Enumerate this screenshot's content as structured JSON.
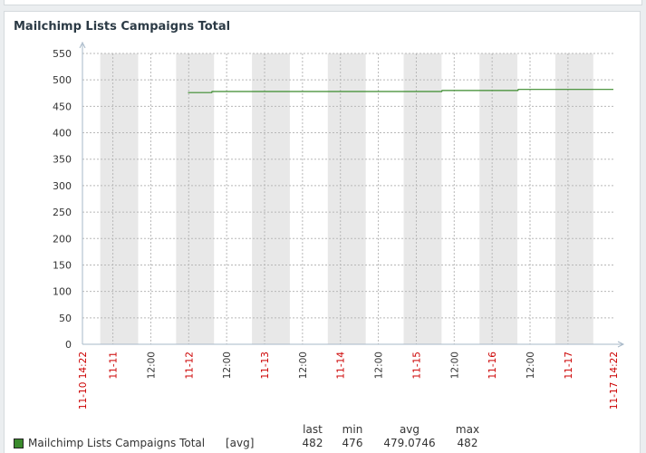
{
  "widget": {
    "title": "Mailchimp Lists Campaigns Total"
  },
  "chart_data": {
    "type": "line",
    "title": "Mailchimp Lists Campaigns Total",
    "ylim": [
      0,
      550
    ],
    "yticks": [
      0,
      50,
      100,
      150,
      200,
      250,
      300,
      350,
      400,
      450,
      500,
      550
    ],
    "x_start": "11-10 14:22",
    "x_end": "11-17 14:22",
    "x_tick_labels": [
      {
        "label": "11-10 14:22",
        "t": 0,
        "color": "#cc0000"
      },
      {
        "label": "11-11",
        "t": 9.63,
        "color": "#cc0000"
      },
      {
        "label": "12:00",
        "t": 21.63,
        "color": "#333333"
      },
      {
        "label": "11-12",
        "t": 33.63,
        "color": "#cc0000"
      },
      {
        "label": "12:00",
        "t": 45.63,
        "color": "#333333"
      },
      {
        "label": "11-13",
        "t": 57.63,
        "color": "#cc0000"
      },
      {
        "label": "12:00",
        "t": 69.63,
        "color": "#333333"
      },
      {
        "label": "11-14",
        "t": 81.63,
        "color": "#cc0000"
      },
      {
        "label": "12:00",
        "t": 93.63,
        "color": "#333333"
      },
      {
        "label": "11-15",
        "t": 105.63,
        "color": "#cc0000"
      },
      {
        "label": "12:00",
        "t": 117.63,
        "color": "#333333"
      },
      {
        "label": "11-16",
        "t": 129.63,
        "color": "#cc0000"
      },
      {
        "label": "12:00",
        "t": 141.63,
        "color": "#333333"
      },
      {
        "label": "11-17",
        "t": 153.63,
        "color": "#cc0000"
      },
      {
        "label": "11-17 14:22",
        "t": 168,
        "color": "#cc0000"
      }
    ],
    "series": [
      {
        "name": "Mailchimp Lists Campaigns Total",
        "func": "[avg]",
        "color": "#3a8a2c",
        "points": [
          [
            33.4,
            476
          ],
          [
            40.9,
            476
          ],
          [
            41.0,
            478
          ],
          [
            113.7,
            478
          ],
          [
            113.8,
            480
          ],
          [
            137.8,
            480
          ],
          [
            137.9,
            482
          ],
          [
            168,
            482
          ]
        ]
      }
    ],
    "legend": {
      "headers": [
        "last",
        "min",
        "avg",
        "max"
      ],
      "values": [
        "482",
        "476",
        "479.0746",
        "482"
      ]
    },
    "colors": {
      "shade": "#e8e8e8",
      "grid": "#b8b8b8",
      "axis": "#a7b8c8",
      "date_label": "#cc0000",
      "time_label": "#333333"
    }
  }
}
